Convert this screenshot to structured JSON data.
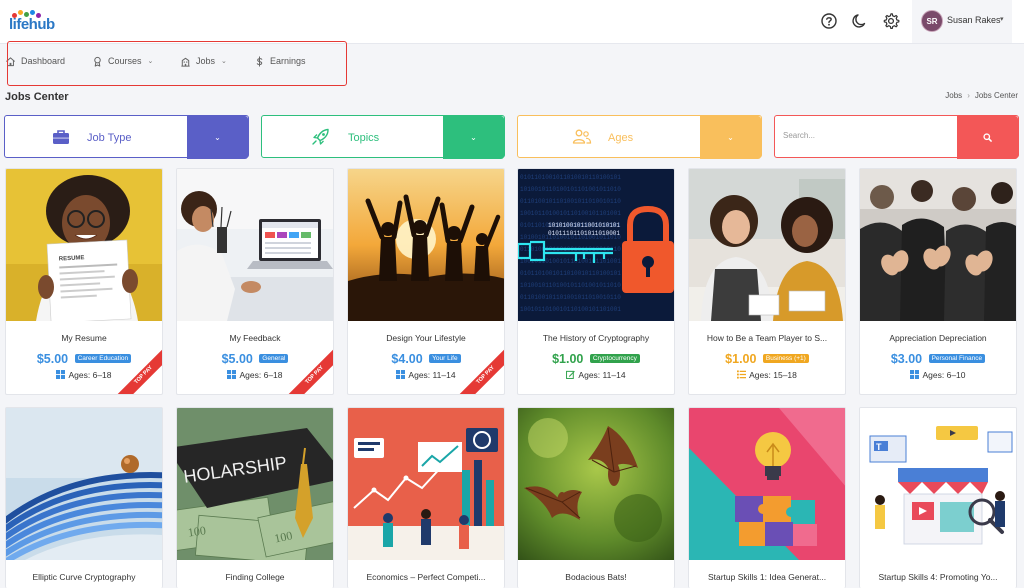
{
  "app": {
    "logo_text": "lifehub"
  },
  "topbar": {
    "icons": [
      "help-icon",
      "moon-icon",
      "gear-icon"
    ]
  },
  "user": {
    "initials": "SR",
    "name": "Susan Rakes",
    "caret": "▾"
  },
  "nav": {
    "items": [
      {
        "label": "Dashboard",
        "icon": "home-icon",
        "has_caret": false
      },
      {
        "label": "Courses",
        "icon": "award-icon",
        "has_caret": true
      },
      {
        "label": "Jobs",
        "icon": "building-icon",
        "has_caret": true
      },
      {
        "label": "Earnings",
        "icon": "dollar-icon",
        "has_caret": false
      }
    ],
    "caret": "⌄"
  },
  "page": {
    "title": "Jobs Center"
  },
  "breadcrumb": {
    "items": [
      "Jobs",
      "Jobs Center"
    ],
    "separator": "›"
  },
  "filters": {
    "job_type": {
      "label": "Job Type",
      "color": "#5a5fc7",
      "button_glyph": "⌄"
    },
    "topics": {
      "label": "Topics",
      "color": "#2dbf7d",
      "button_glyph": "⌄"
    },
    "ages": {
      "label": "Ages",
      "color": "#f9bf5c",
      "button_glyph": "⌄"
    },
    "search": {
      "placeholder": "Search...",
      "color": "#f35757",
      "button_icon": "search-icon"
    }
  },
  "colors": {
    "price_blue": "#3a8fe0",
    "price_green": "#31a24c",
    "price_orange": "#f0a720",
    "ribbon": "#e53935"
  },
  "jobs": [
    {
      "title": "My Resume",
      "price": "$5.00",
      "category": "Career Education",
      "ages_label": "Ages:",
      "ages": "6–18",
      "age_icon": "windows-icon",
      "badge": "TOP PAY",
      "price_color": "#3a8fe0",
      "cat_color": "#3a8fe0"
    },
    {
      "title": "My Feedback",
      "price": "$5.00",
      "category": "General",
      "ages_label": "Ages:",
      "ages": "6–18",
      "age_icon": "windows-icon",
      "badge": "TOP PAY",
      "price_color": "#3a8fe0",
      "cat_color": "#3a8fe0"
    },
    {
      "title": "Design Your Lifestyle",
      "price": "$4.00",
      "category": "Your Life",
      "ages_label": "Ages:",
      "ages": "11–14",
      "age_icon": "windows-icon",
      "badge": "TOP PAY",
      "price_color": "#3a8fe0",
      "cat_color": "#3a8fe0"
    },
    {
      "title": "The History of Cryptography",
      "price": "$1.00",
      "category": "Cryptocurrency",
      "ages_label": "Ages:",
      "ages": "11–14",
      "age_icon": "edit-icon",
      "badge": "",
      "price_color": "#31a24c",
      "cat_color": "#31a24c"
    },
    {
      "title": "How to Be a Team Player to S...",
      "price": "$1.00",
      "category": "Business (+1)",
      "ages_label": "Ages:",
      "ages": "15–18",
      "age_icon": "list-icon",
      "badge": "",
      "price_color": "#f0a720",
      "cat_color": "#f0a720"
    },
    {
      "title": "Appreciation Depreciation",
      "price": "$3.00",
      "category": "Personal Finance",
      "ages_label": "Ages:",
      "ages": "6–10",
      "age_icon": "windows-icon",
      "badge": "",
      "price_color": "#3a8fe0",
      "cat_color": "#3a8fe0"
    },
    {
      "title": "Elliptic Curve Cryptography"
    },
    {
      "title": "Finding College"
    },
    {
      "title": "Economics – Perfect Competi..."
    },
    {
      "title": "Bodacious Bats!"
    },
    {
      "title": "Startup Skills 1: Idea Generat..."
    },
    {
      "title": "Startup Skills 4: Promoting Yo..."
    }
  ]
}
